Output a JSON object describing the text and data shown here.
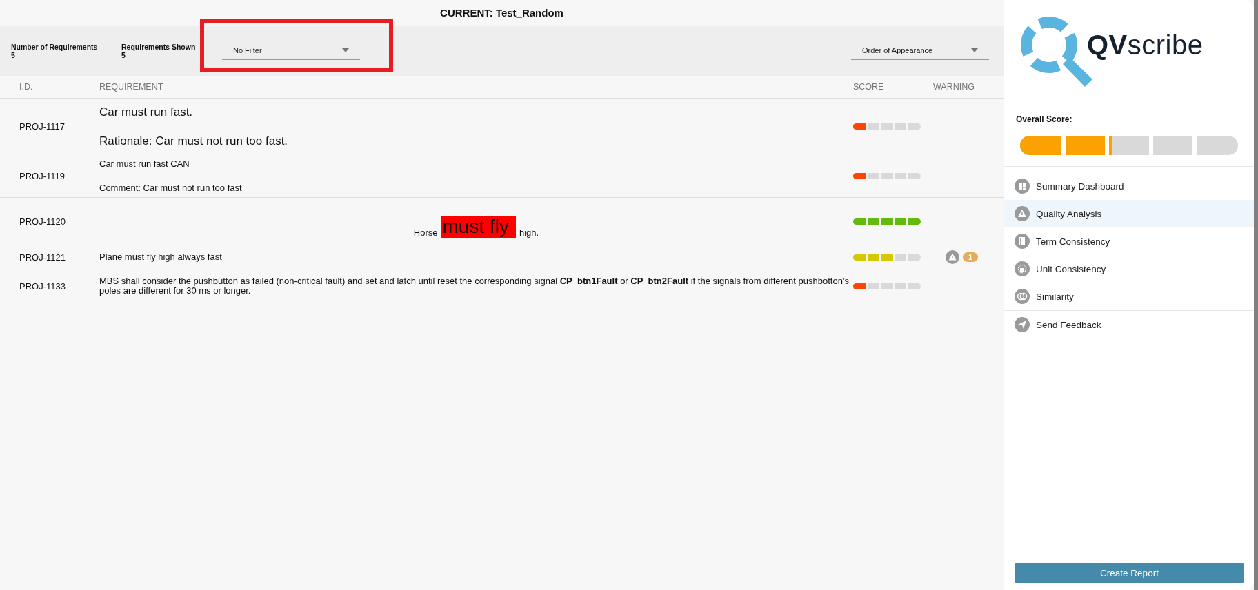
{
  "title": "CURRENT: Test_Random",
  "stats": [
    {
      "label": "Number of Requirements",
      "value": "5"
    },
    {
      "label": "Requirements Shown",
      "value": "5"
    }
  ],
  "filter": {
    "value": "No Filter",
    "highlighted": true
  },
  "sort": {
    "value": "Order of Appearance"
  },
  "table": {
    "columns": [
      "I.D.",
      "REQUIREMENT",
      "SCORE",
      "WARNING"
    ],
    "rows": [
      {
        "id": "PROJ-1117",
        "kind": "large",
        "lines": [
          "Car must run fast.",
          "Rationale: Car must not run too fast."
        ],
        "score": {
          "level": 0.2,
          "color": "#ff4500"
        }
      },
      {
        "id": "PROJ-1119",
        "kind": "spaced",
        "lines": [
          "Car must run fast CAN",
          "Comment: Car must not run too fast"
        ],
        "score": {
          "level": 0.2,
          "color": "#ff4500"
        }
      },
      {
        "id": "PROJ-1120",
        "kind": "highlight",
        "parts": [
          {
            "text": "Horse",
            "highlighted": false
          },
          {
            "text": "must fly",
            "highlighted": true
          },
          {
            "text": "high.",
            "highlighted": false
          }
        ],
        "score": {
          "level": 1,
          "color": "#62bb0b"
        }
      },
      {
        "id": "PROJ-1121",
        "kind": "plain",
        "lines": [
          "Plane must fly high always fast"
        ],
        "score": {
          "level": 0.6,
          "color": "#d6c800"
        },
        "warning": {
          "count": "1"
        }
      },
      {
        "id": "PROJ-1133",
        "kind": "plain",
        "lines": [
          "MBS shall consider the pushbutton as failed (non-critical fault) and set and latch until reset the corresponding signal **CP_btn1Fault** or **CP_btn2Fault** if the signals from different pushbotton’s poles are different for 30 ms or longer."
        ],
        "score": {
          "level": 0.2,
          "color": "#ff4500"
        }
      }
    ]
  },
  "sidebar": {
    "logo": "**QV**scribe",
    "overall_label": "Overall Score:",
    "overall": {
      "level": 0.42,
      "color": "#fba100"
    },
    "nav": [
      {
        "label": "Summary Dashboard",
        "kind": "dashboard",
        "selected": false
      },
      {
        "label": "Quality Analysis",
        "kind": "warning",
        "selected": true
      },
      {
        "label": "Term Consistency",
        "kind": "book",
        "selected": false
      },
      {
        "label": "Unit Consistency",
        "kind": "units",
        "selected": false
      },
      {
        "label": "Similarity",
        "kind": "similarity",
        "selected": false
      }
    ],
    "feedback": {
      "label": "Send Feedback",
      "kind": "send"
    },
    "button": "Create Report"
  }
}
